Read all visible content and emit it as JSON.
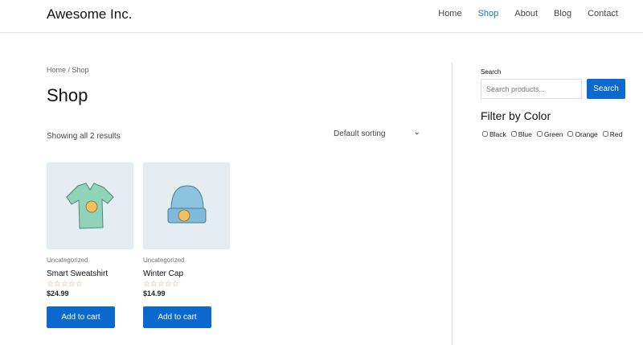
{
  "header": {
    "logo": "Awesome Inc.",
    "nav": [
      "Home",
      "Shop",
      "About",
      "Blog",
      "Contact"
    ],
    "active": "Shop"
  },
  "breadcrumb": "Home / Shop",
  "page_title": "Shop",
  "result_count": "Showing all 2 results",
  "sorting": "Default sorting",
  "products": [
    {
      "category": "Uncategorized",
      "name": "Smart Sweatshirt",
      "rating": 0,
      "stars": "☆☆☆☆☆",
      "price": "$24.99",
      "button": "Add to cart",
      "image": "t-shirt"
    },
    {
      "category": "Uncategorized",
      "name": "Winter Cap",
      "rating": 0,
      "stars": "☆☆☆☆☆",
      "price": "$14.99",
      "button": "Add to cart",
      "image": "beanie"
    }
  ],
  "sidebar": {
    "search_label": "Search",
    "search_placeholder": "Search products...",
    "search_button": "Search",
    "filter_title": "Filter by Color",
    "colors": [
      "Black",
      "Blue",
      "Green",
      "Orange",
      "Red"
    ]
  },
  "colors": {
    "accent": "#0b68cf",
    "nav_active": "#1a6fc0"
  }
}
